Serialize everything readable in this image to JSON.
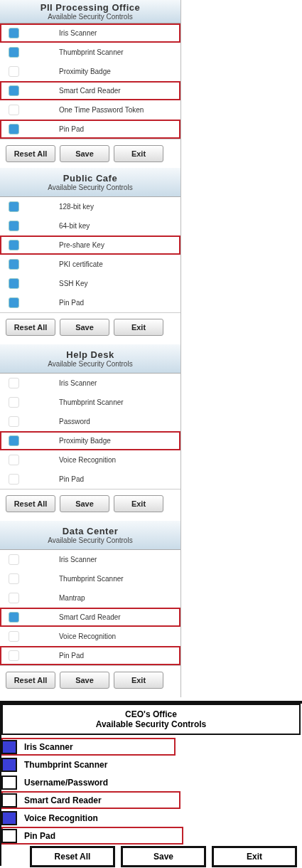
{
  "panels": [
    {
      "kind": "glossy",
      "title": "PII Processing Office",
      "subtitle": "Available Security Controls",
      "controls": [
        {
          "label": "Iris Scanner",
          "checked": true,
          "highlighted": true
        },
        {
          "label": "Thumbprint Scanner",
          "checked": true,
          "highlighted": false
        },
        {
          "label": "Proximity Badge",
          "checked": false,
          "highlighted": false
        },
        {
          "label": "Smart Card Reader",
          "checked": true,
          "highlighted": true
        },
        {
          "label": "One Time Password Token",
          "checked": false,
          "highlighted": false
        },
        {
          "label": "Pin Pad",
          "checked": true,
          "highlighted": true
        }
      ],
      "buttons": [
        "Reset All",
        "Save",
        "Exit"
      ]
    },
    {
      "kind": "glossy",
      "title": "Public Cafe",
      "subtitle": "Available Security Controls",
      "controls": [
        {
          "label": "128-bit key",
          "checked": true,
          "highlighted": false
        },
        {
          "label": "64-bit key",
          "checked": true,
          "highlighted": false
        },
        {
          "label": "Pre-share Key",
          "checked": true,
          "highlighted": true
        },
        {
          "label": "PKI certificate",
          "checked": true,
          "highlighted": false
        },
        {
          "label": "SSH Key",
          "checked": true,
          "highlighted": false
        },
        {
          "label": "Pin Pad",
          "checked": true,
          "highlighted": false
        }
      ],
      "buttons": [
        "Reset All",
        "Save",
        "Exit"
      ]
    },
    {
      "kind": "glossy",
      "title": "Help Desk",
      "subtitle": "Available Security Controls",
      "controls": [
        {
          "label": "Iris Scanner",
          "checked": false,
          "highlighted": false
        },
        {
          "label": "Thumbprint Scanner",
          "checked": false,
          "highlighted": false
        },
        {
          "label": "Password",
          "checked": false,
          "highlighted": false
        },
        {
          "label": "Proximity Badge",
          "checked": true,
          "highlighted": true
        },
        {
          "label": "Voice Recognition",
          "checked": false,
          "highlighted": false
        },
        {
          "label": "Pin Pad",
          "checked": false,
          "highlighted": false
        }
      ],
      "buttons": [
        "Reset All",
        "Save",
        "Exit"
      ]
    },
    {
      "kind": "glossy",
      "title": "Data Center",
      "subtitle": "Available Security Controls",
      "controls": [
        {
          "label": "Iris Scanner",
          "checked": false,
          "highlighted": false
        },
        {
          "label": "Thumbprint Scanner",
          "checked": false,
          "highlighted": false
        },
        {
          "label": "Mantrap",
          "checked": false,
          "highlighted": false
        },
        {
          "label": "Smart Card Reader",
          "checked": true,
          "highlighted": true
        },
        {
          "label": "Voice Recognition",
          "checked": false,
          "highlighted": false
        },
        {
          "label": "Pin Pad",
          "checked": false,
          "highlighted": true
        }
      ],
      "buttons": [
        "Reset All",
        "Save",
        "Exit"
      ]
    },
    {
      "kind": "plain",
      "title": "CEO's Office",
      "subtitle": "Available Security Controls",
      "controls": [
        {
          "label": "Iris Scanner",
          "checked": true,
          "highlighted": true
        },
        {
          "label": "Thumbprint Scanner",
          "checked": true,
          "highlighted": false
        },
        {
          "label": "Username/Password",
          "checked": false,
          "highlighted": false
        },
        {
          "label": "Smart Card Reader",
          "checked": false,
          "highlighted": true
        },
        {
          "label": "Voice Recognition",
          "checked": true,
          "highlighted": false
        },
        {
          "label": "Pin Pad",
          "checked": false,
          "highlighted": true
        }
      ],
      "buttons": [
        "Reset All",
        "Save",
        "Exit"
      ]
    }
  ]
}
